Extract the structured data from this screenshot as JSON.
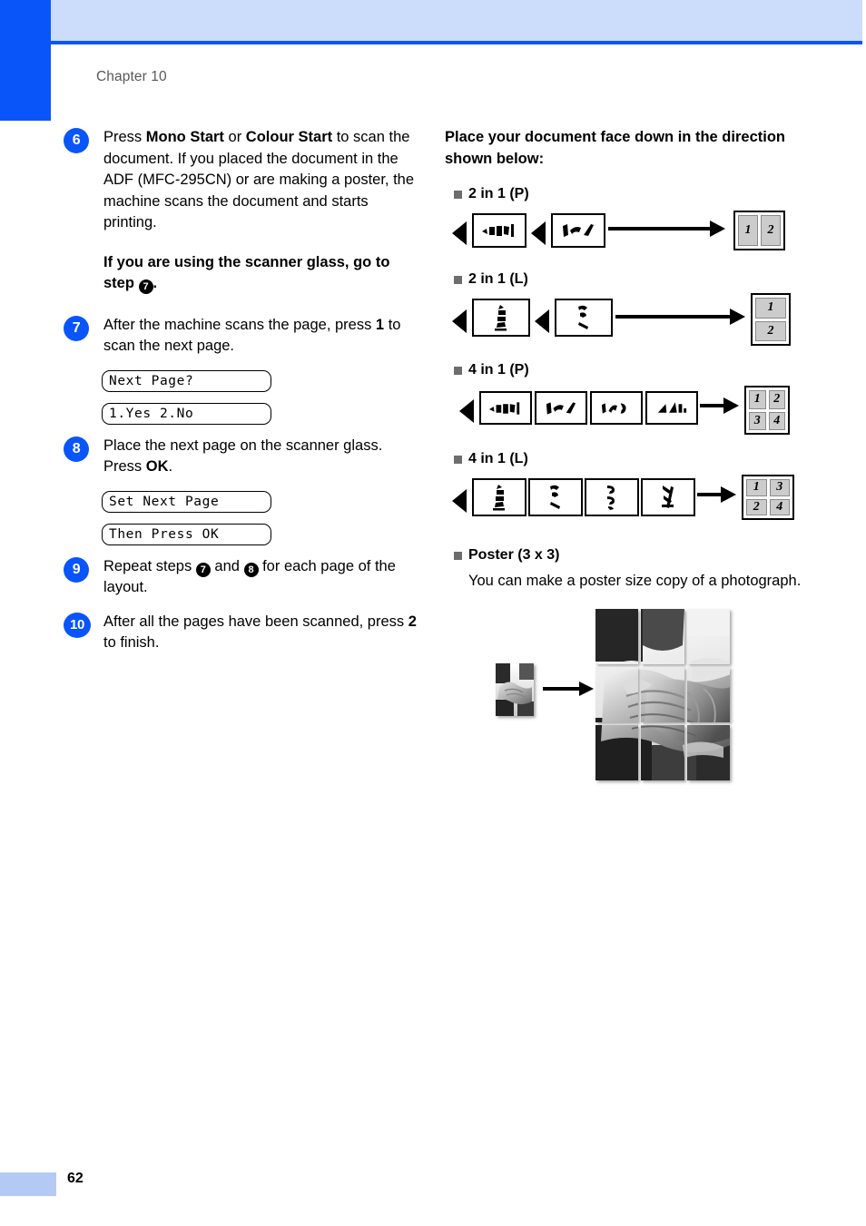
{
  "page": {
    "chapter_label": "Chapter 10",
    "page_number": "62",
    "accent_blue": "#0a55fa",
    "header_band": "#ccdcfb",
    "footer_bar": "#b5c9f5"
  },
  "left_column": {
    "steps": [
      {
        "number": "6",
        "text_parts": [
          {
            "t": "Press ",
            "bold": false
          },
          {
            "t": "Mono Start",
            "bold": true
          },
          {
            "t": " or ",
            "bold": false
          },
          {
            "t": "Colour Start",
            "bold": true
          },
          {
            "t": " to scan the document. If you placed the document in the ADF (MFC-295CN) or are making a poster, the machine scans the document and starts printing.",
            "bold": false
          }
        ],
        "note": "If you are using the scanner glass, go to step ",
        "note_ref": "7",
        "note_tail": "."
      },
      {
        "number": "7",
        "text_parts": [
          {
            "t": "After the machine scans the page, press ",
            "bold": false
          },
          {
            "t": "1",
            "bold": true
          },
          {
            "t": " to scan the next page.",
            "bold": false
          }
        ],
        "lcd": [
          "Next Page?",
          "1.Yes 2.No"
        ]
      },
      {
        "number": "8",
        "text_parts": [
          {
            "t": "Place the next page on the scanner glass. Press ",
            "bold": false
          },
          {
            "t": "OK",
            "bold": true
          },
          {
            "t": ".",
            "bold": false
          }
        ],
        "lcd": [
          "Set Next Page",
          "Then Press OK"
        ]
      },
      {
        "number": "9",
        "text_parts": [
          {
            "t": "Repeat steps ",
            "bold": false
          },
          {
            "t": "@7",
            "bold": false
          },
          {
            "t": " and ",
            "bold": false
          },
          {
            "t": "@8",
            "bold": false
          },
          {
            "t": " for each page of the layout.",
            "bold": false
          }
        ]
      },
      {
        "number": "10",
        "text_parts": [
          {
            "t": "After all the pages have been scanned, press ",
            "bold": false
          },
          {
            "t": "2",
            "bold": true
          },
          {
            "t": " to finish.",
            "bold": false
          }
        ]
      }
    ]
  },
  "right_column": {
    "intro": "Place your document face down in the direction shown below:",
    "sections": [
      {
        "label": "2 in 1 (P)",
        "pages": 2,
        "orientation": "P",
        "triangles": 2,
        "result_rows": 1,
        "result_cols": 2,
        "result_cells": [
          "1",
          "2"
        ]
      },
      {
        "label": "2 in 1 (L)",
        "pages": 2,
        "orientation": "L",
        "triangles": 2,
        "result_rows": 2,
        "result_cols": 1,
        "result_cells": [
          "1",
          "2"
        ]
      },
      {
        "label": "4 in 1 (P)",
        "pages": 4,
        "orientation": "P",
        "triangles": 1,
        "result_rows": 2,
        "result_cols": 2,
        "result_cells": [
          "1",
          "2",
          "3",
          "4"
        ]
      },
      {
        "label": "4 in 1 (L)",
        "pages": 4,
        "orientation": "L",
        "triangles": 1,
        "result_rows": 2,
        "result_cols": 2,
        "result_cells": [
          "1",
          "3",
          "2",
          "4"
        ]
      }
    ],
    "poster": {
      "label": "Poster (3 x 3)",
      "text": "You can make a poster size copy of a photograph.",
      "image_description": "handshake-photograph"
    }
  },
  "icons": {
    "bullet": "filled-square-bullet",
    "arrow": "right-arrow-icon",
    "triangle": "left-triangle-feed-direction-icon",
    "page_glyph": "rotated-page-number-glyph"
  }
}
